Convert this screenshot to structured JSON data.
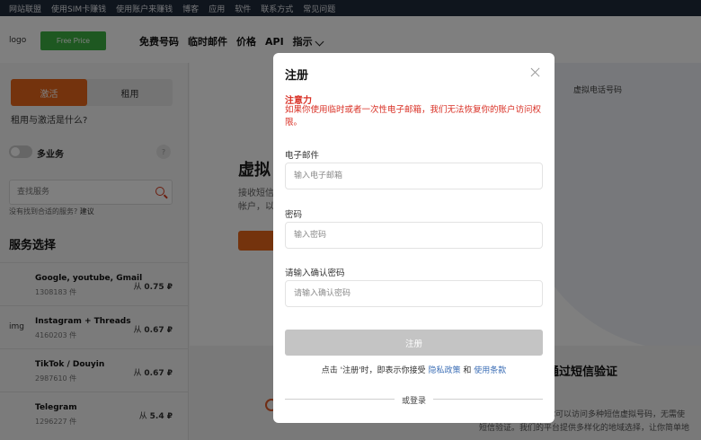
{
  "topnav": {
    "items": [
      "网站联盟",
      "使用SIM卡赚钱",
      "使用账户来赚钱",
      "博客",
      "应用",
      "软件",
      "联系方式",
      "常见问题"
    ]
  },
  "header": {
    "logo": "logo",
    "free_price": "Free Price",
    "nav": [
      "免费号码",
      "临时邮件",
      "价格",
      "API",
      "指示"
    ]
  },
  "sidebar": {
    "tab_activate": "激活",
    "tab_rent": "租用",
    "diff_link": "租用与激活是什么?",
    "multi_service": "多业务",
    "help": "?",
    "search_placeholder": "查找服务",
    "not_found": "没有找到合适的服务?",
    "suggest": "建议",
    "services_title": "服务选择",
    "services": [
      {
        "img": "",
        "name": "Google, youtube, Gmail",
        "count": "1308183 件",
        "price_prefix": "从",
        "price": "0.75 ₽"
      },
      {
        "img": "img",
        "name": "Instagram + Threads",
        "count": "4160203 件",
        "price_prefix": "从",
        "price": "0.67 ₽"
      },
      {
        "img": "",
        "name": "TikTok / Douyin",
        "count": "2987610 件",
        "price_prefix": "从",
        "price": "0.67 ₽"
      },
      {
        "img": "",
        "name": "Telegram",
        "count": "1296227 件",
        "price_prefix": "从",
        "price": "5.4 ₽"
      }
    ]
  },
  "main": {
    "phone_label": "虚拟电话号码",
    "hero_title": "虚拟",
    "hero_desc_1": "接收短信",
    "hero_desc_2": "帐户，以",
    "hero_btn": "卖",
    "sec2_title": "通过短信验证",
    "sec2_text_1": "你可以访问多种短信虚拟号码，无需使",
    "sec2_text_2": "短信验证。我们的平台提供多样化的地域选择，让你简单地"
  },
  "modal": {
    "title": "注册",
    "warning_title": "注意力",
    "warning_text": "如果你使用临时或者一次性电子邮箱，我们无法恢复你的账户访问权限。",
    "email_label": "电子邮件",
    "email_placeholder": "输入电子邮箱",
    "password_label": "密码",
    "password_placeholder": "输入密码",
    "confirm_label": "请输入确认密码",
    "confirm_placeholder": "请输入确认密码",
    "submit": "注册",
    "terms_prefix": "点击 '注册'时，即表示你接受",
    "privacy": "隐私政策",
    "and": "和",
    "terms_of_use": "使用条款",
    "or_login": "或登录"
  }
}
